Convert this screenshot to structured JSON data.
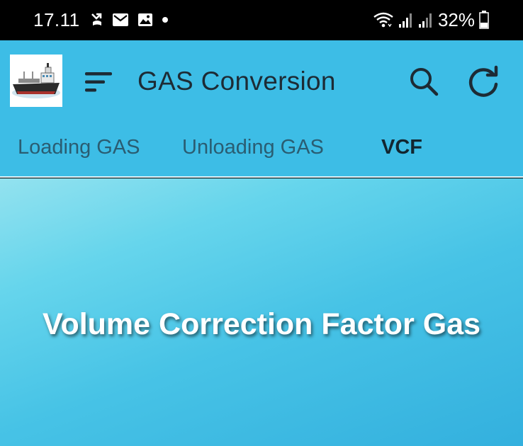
{
  "status_bar": {
    "time": "17.11",
    "battery_percent": "32%",
    "icons_left": [
      "missed-call-icon",
      "mail-icon",
      "gallery-icon",
      "dot-icon"
    ],
    "icons_right": [
      "wifi-icon",
      "signal-icon",
      "signal-icon",
      "battery-icon"
    ]
  },
  "app_bar": {
    "title": "GAS Conversion",
    "logo": "ship-logo",
    "background": "#3dbde6"
  },
  "tabs": [
    {
      "label": "Loading GAS",
      "active": false
    },
    {
      "label": "Unloading GAS",
      "active": false
    },
    {
      "label": "VCF",
      "active": true
    }
  ],
  "content": {
    "heading": "Volume Correction Factor Gas"
  }
}
